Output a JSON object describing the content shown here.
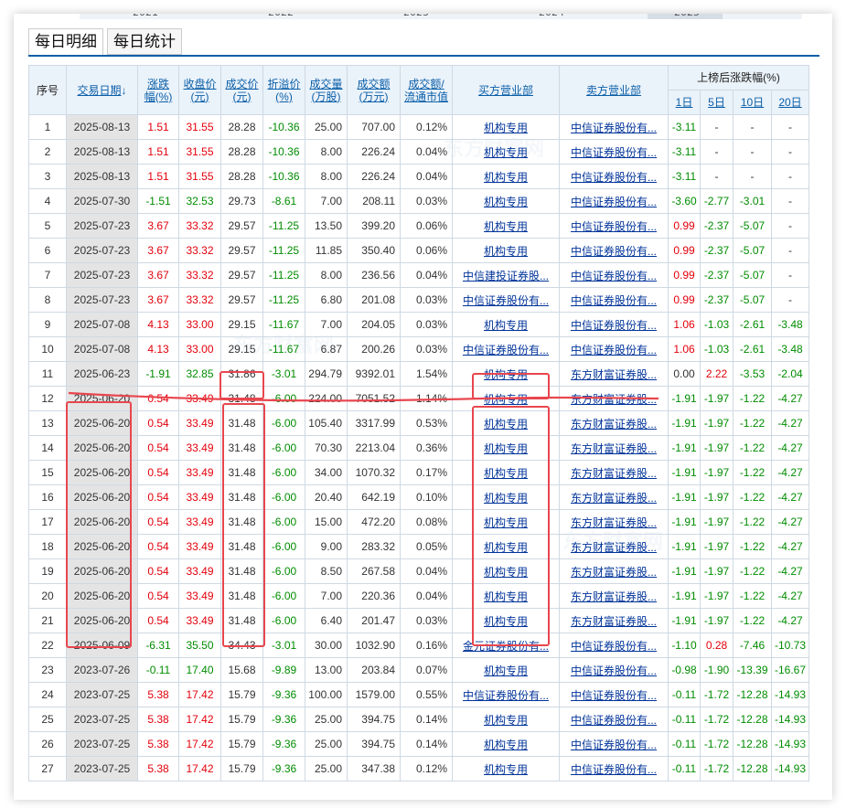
{
  "top_axis": {
    "labels": [
      "2021",
      "2022",
      "2023",
      "2024",
      "2025"
    ]
  },
  "tabs": [
    {
      "label": "每日明细",
      "active": true
    },
    {
      "label": "每日统计",
      "active": false
    }
  ],
  "table": {
    "headers": {
      "idx": "序号",
      "date": "交易日期",
      "change_pct": "涨跌幅(%)",
      "close": "收盘价(元)",
      "deal_price": "成交价(元)",
      "premium": "折溢价(%)",
      "volume": "成交量(万股)",
      "amount": "成交额(万元)",
      "ratio": "成交额/流通市值",
      "buyer": "买方营业部",
      "seller": "卖方营业部",
      "after_group": "上榜后涨跌幅(%)",
      "after_1": "1日",
      "after_5": "5日",
      "after_10": "10日",
      "after_20": "20日"
    },
    "rows": [
      [
        "1",
        "2025-08-13",
        "1.51",
        "31.55",
        "28.28",
        "-10.36",
        "25.00",
        "707.00",
        "0.12%",
        "机构专用",
        "中信证券股份有...",
        "-3.11",
        "-",
        "-",
        "-"
      ],
      [
        "2",
        "2025-08-13",
        "1.51",
        "31.55",
        "28.28",
        "-10.36",
        "8.00",
        "226.24",
        "0.04%",
        "机构专用",
        "中信证券股份有...",
        "-3.11",
        "-",
        "-",
        "-"
      ],
      [
        "3",
        "2025-08-13",
        "1.51",
        "31.55",
        "28.28",
        "-10.36",
        "8.00",
        "226.24",
        "0.04%",
        "机构专用",
        "中信证券股份有...",
        "-3.11",
        "-",
        "-",
        "-"
      ],
      [
        "4",
        "2025-07-30",
        "-1.51",
        "32.53",
        "29.73",
        "-8.61",
        "7.00",
        "208.11",
        "0.03%",
        "机构专用",
        "中信证券股份有...",
        "-3.60",
        "-2.77",
        "-3.01",
        "-"
      ],
      [
        "5",
        "2025-07-23",
        "3.67",
        "33.32",
        "29.57",
        "-11.25",
        "13.50",
        "399.20",
        "0.06%",
        "机构专用",
        "中信证券股份有...",
        "0.99",
        "-2.37",
        "-5.07",
        "-"
      ],
      [
        "6",
        "2025-07-23",
        "3.67",
        "33.32",
        "29.57",
        "-11.25",
        "11.85",
        "350.40",
        "0.06%",
        "机构专用",
        "中信证券股份有...",
        "0.99",
        "-2.37",
        "-5.07",
        "-"
      ],
      [
        "7",
        "2025-07-23",
        "3.67",
        "33.32",
        "29.57",
        "-11.25",
        "8.00",
        "236.56",
        "0.04%",
        "中信建投证券股...",
        "中信证券股份有...",
        "0.99",
        "-2.37",
        "-5.07",
        "-"
      ],
      [
        "8",
        "2025-07-23",
        "3.67",
        "33.32",
        "29.57",
        "-11.25",
        "6.80",
        "201.08",
        "0.03%",
        "中信证券股份有...",
        "中信证券股份有...",
        "0.99",
        "-2.37",
        "-5.07",
        "-"
      ],
      [
        "9",
        "2025-07-08",
        "4.13",
        "33.00",
        "29.15",
        "-11.67",
        "7.00",
        "204.05",
        "0.03%",
        "机构专用",
        "中信证券股份有...",
        "1.06",
        "-1.03",
        "-2.61",
        "-3.48"
      ],
      [
        "10",
        "2025-07-08",
        "4.13",
        "33.00",
        "29.15",
        "-11.67",
        "6.87",
        "200.26",
        "0.03%",
        "中信证券股份有...",
        "中信证券股份有...",
        "1.06",
        "-1.03",
        "-2.61",
        "-3.48"
      ],
      [
        "11",
        "2025-06-23",
        "-1.91",
        "32.85",
        "31.86",
        "-3.01",
        "294.79",
        "9392.01",
        "1.54%",
        "机构专用",
        "东方财富证券股...",
        "0.00",
        "2.22",
        "-3.53",
        "-2.04"
      ],
      [
        "12",
        "2025-06-20",
        "0.54",
        "33.49",
        "31.48",
        "-6.00",
        "224.00",
        "7051.52",
        "1.14%",
        "机构专用",
        "东方财富证券股...",
        "-1.91",
        "-1.97",
        "-1.22",
        "-4.27"
      ],
      [
        "13",
        "2025-06-20",
        "0.54",
        "33.49",
        "31.48",
        "-6.00",
        "105.40",
        "3317.99",
        "0.53%",
        "机构专用",
        "东方财富证券股...",
        "-1.91",
        "-1.97",
        "-1.22",
        "-4.27"
      ],
      [
        "14",
        "2025-06-20",
        "0.54",
        "33.49",
        "31.48",
        "-6.00",
        "70.30",
        "2213.04",
        "0.36%",
        "机构专用",
        "东方财富证券股...",
        "-1.91",
        "-1.97",
        "-1.22",
        "-4.27"
      ],
      [
        "15",
        "2025-06-20",
        "0.54",
        "33.49",
        "31.48",
        "-6.00",
        "34.00",
        "1070.32",
        "0.17%",
        "机构专用",
        "东方财富证券股...",
        "-1.91",
        "-1.97",
        "-1.22",
        "-4.27"
      ],
      [
        "16",
        "2025-06-20",
        "0.54",
        "33.49",
        "31.48",
        "-6.00",
        "20.40",
        "642.19",
        "0.10%",
        "机构专用",
        "东方财富证券股...",
        "-1.91",
        "-1.97",
        "-1.22",
        "-4.27"
      ],
      [
        "17",
        "2025-06-20",
        "0.54",
        "33.49",
        "31.48",
        "-6.00",
        "15.00",
        "472.20",
        "0.08%",
        "机构专用",
        "东方财富证券股...",
        "-1.91",
        "-1.97",
        "-1.22",
        "-4.27"
      ],
      [
        "18",
        "2025-06-20",
        "0.54",
        "33.49",
        "31.48",
        "-6.00",
        "9.00",
        "283.32",
        "0.05%",
        "机构专用",
        "东方财富证券股...",
        "-1.91",
        "-1.97",
        "-1.22",
        "-4.27"
      ],
      [
        "19",
        "2025-06-20",
        "0.54",
        "33.49",
        "31.48",
        "-6.00",
        "8.50",
        "267.58",
        "0.04%",
        "机构专用",
        "东方财富证券股...",
        "-1.91",
        "-1.97",
        "-1.22",
        "-4.27"
      ],
      [
        "20",
        "2025-06-20",
        "0.54",
        "33.49",
        "31.48",
        "-6.00",
        "7.00",
        "220.36",
        "0.04%",
        "机构专用",
        "东方财富证券股...",
        "-1.91",
        "-1.97",
        "-1.22",
        "-4.27"
      ],
      [
        "21",
        "2025-06-20",
        "0.54",
        "33.49",
        "31.48",
        "-6.00",
        "6.40",
        "201.47",
        "0.03%",
        "机构专用",
        "东方财富证券股...",
        "-1.91",
        "-1.97",
        "-1.22",
        "-4.27"
      ],
      [
        "22",
        "2025-06-09",
        "-6.31",
        "35.50",
        "34.43",
        "-3.01",
        "30.00",
        "1032.90",
        "0.16%",
        "金元证券股份有...",
        "中信证券股份有...",
        "-1.10",
        "0.28",
        "-7.46",
        "-10.73"
      ],
      [
        "23",
        "2023-07-26",
        "-0.11",
        "17.40",
        "15.68",
        "-9.89",
        "13.00",
        "203.84",
        "0.07%",
        "机构专用",
        "中信证券股份有...",
        "-0.98",
        "-1.90",
        "-13.39",
        "-16.67"
      ],
      [
        "24",
        "2023-07-25",
        "5.38",
        "17.42",
        "15.79",
        "-9.36",
        "100.00",
        "1579.00",
        "0.55%",
        "中信证券股份有...",
        "中信证券股份有...",
        "-0.11",
        "-1.72",
        "-12.28",
        "-14.93"
      ],
      [
        "25",
        "2023-07-25",
        "5.38",
        "17.42",
        "15.79",
        "-9.36",
        "25.00",
        "394.75",
        "0.14%",
        "机构专用",
        "中信证券股份有...",
        "-0.11",
        "-1.72",
        "-12.28",
        "-14.93"
      ],
      [
        "26",
        "2023-07-25",
        "5.38",
        "17.42",
        "15.79",
        "-9.36",
        "25.00",
        "394.75",
        "0.14%",
        "机构专用",
        "中信证券股份有...",
        "-0.11",
        "-1.72",
        "-12.28",
        "-14.93"
      ],
      [
        "27",
        "2023-07-25",
        "5.38",
        "17.42",
        "15.79",
        "-9.36",
        "25.00",
        "347.38",
        "0.12%",
        "机构专用",
        "中信证券股份有...",
        "-0.11",
        "-1.72",
        "-12.28",
        "-14.93"
      ]
    ]
  },
  "colors": {
    "up": "#e3000b",
    "down": "#008c00",
    "link": "#003399",
    "header_link": "#0b5fa8",
    "annotation": "#e8464e"
  }
}
